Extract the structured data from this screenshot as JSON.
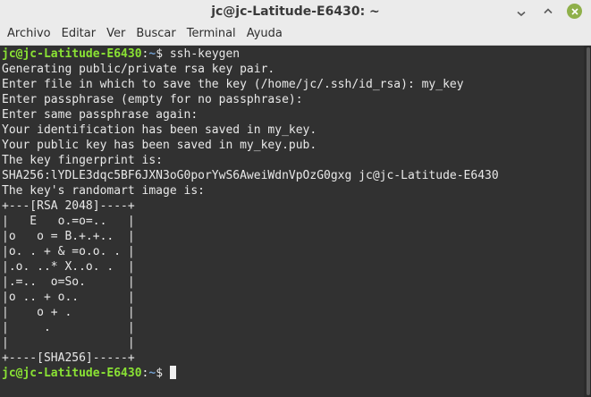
{
  "window": {
    "title": "jc@jc-Latitude-E6430: ~"
  },
  "menu": {
    "items": [
      "Archivo",
      "Editar",
      "Ver",
      "Buscar",
      "Terminal",
      "Ayuda"
    ]
  },
  "colors": {
    "terminal_bg": "#313131",
    "prompt_user": "#8ae234",
    "prompt_path": "#729fcf",
    "text": "#e8e8e8",
    "close_button": "#8fb04a"
  },
  "icons": [
    "minimize-icon",
    "maximize-icon",
    "close-icon"
  ],
  "terminal": {
    "prompt_user": "jc@jc-Latitude-E6430",
    "prompt_sep": ":",
    "prompt_path": "~",
    "prompt_symbol": "$ ",
    "command": "ssh-keygen",
    "output": [
      "Generating public/private rsa key pair.",
      "Enter file in which to save the key (/home/jc/.ssh/id_rsa): my_key",
      "Enter passphrase (empty for no passphrase):",
      "Enter same passphrase again:",
      "Your identification has been saved in my_key.",
      "Your public key has been saved in my_key.pub.",
      "The key fingerprint is:",
      "SHA256:lYDLE3dqc5BF6JXN3oG0porYwS6AweiWdnVpOzG0gxg jc@jc-Latitude-E6430",
      "The key's randomart image is:",
      "+---[RSA 2048]----+",
      "|   E   o.=o=..   |",
      "|o   o = B.+.+..  |",
      "|o. . + & =o.o. . |",
      "|.o. ..* X..o. .  |",
      "|.=..  o=So.      |",
      "|o .. + o..       |",
      "|    o + .        |",
      "|     .           |",
      "|                 |",
      "+----[SHA256]-----+"
    ]
  }
}
